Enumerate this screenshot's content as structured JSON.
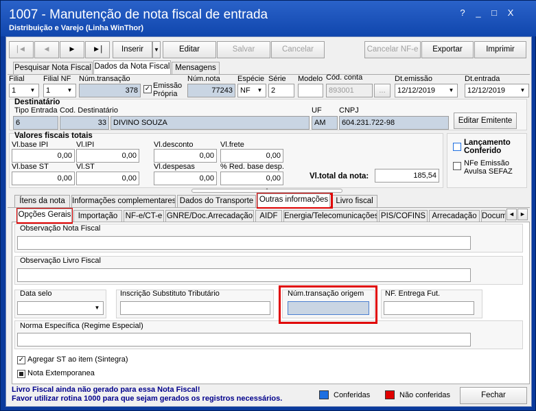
{
  "window": {
    "title": "1007 - Manutenção de nota fiscal de entrada",
    "subtitle": "Distribuição e Varejo (Linha WinThor)",
    "controls": [
      "?",
      "_",
      "□",
      "X"
    ]
  },
  "toolbar": {
    "first": "|◄",
    "prev": "◄",
    "next": "►",
    "last": "►|",
    "insert": "Inserir",
    "edit": "Editar",
    "save": "Salvar",
    "cancel": "Cancelar",
    "cancel_nfe": "Cancelar NF-e",
    "export": "Exportar",
    "print": "Imprimir"
  },
  "main_tabs": [
    "Pesquisar Nota Fiscal",
    "Dados da Nota Fiscal",
    "Mensagens"
  ],
  "header_fields": {
    "filial_label": "Filial",
    "filial_value": "1",
    "filial_nf_label": "Filial NF",
    "filial_nf_value": "1",
    "num_transacao_label": "Núm.transação",
    "num_transacao_value": "378",
    "emissao_propria_label": "Emissão Própria",
    "num_nota_label": "Núm.nota",
    "num_nota_value": "77243",
    "especie_label": "Espécie",
    "especie_value": "NF",
    "serie_label": "Série",
    "serie_value": "2",
    "modelo_label": "Modelo",
    "modelo_value": "",
    "cod_conta_label": "Cód. conta",
    "cod_conta_value": "893001",
    "cod_conta_btn": "...",
    "dt_emissao_label": "Dt.emissão",
    "dt_emissao_value": "12/12/2019",
    "dt_entrada_label": "Dt.entrada",
    "dt_entrada_value": "12/12/2019"
  },
  "destinatario": {
    "title": "Destinatário",
    "tipo_entrada_label": "Tipo Entrada",
    "tipo_entrada_value": "6",
    "cod_dest_label": "Cod. Destinatário",
    "cod_dest_value": "33",
    "nome_value": "DIVINO SOUZA",
    "uf_label": "UF",
    "uf_value": "AM",
    "cnpj_label": "CNPJ",
    "cnpj_value": "604.231.722-98",
    "edit_btn": "Editar Emitente"
  },
  "valores": {
    "title": "Valores fiscais totais",
    "vl_base_ipi_label": "Vl.base IPI",
    "vl_base_ipi": "0,00",
    "vl_ipi_label": "Vl.IPI",
    "vl_ipi": "0,00",
    "vl_desconto_label": "Vl.desconto",
    "vl_desconto": "0,00",
    "vl_frete_label": "Vl.frete",
    "vl_frete": "0,00",
    "vl_base_st_label": "Vl.base ST",
    "vl_base_st": "0,00",
    "vl_st_label": "Vl.ST",
    "vl_st": "0,00",
    "vl_despesas_label": "Vl.despesas",
    "vl_despesas": "0,00",
    "red_base_label": "% Red. base desp.",
    "red_base": "0,00",
    "vl_total_label": "Vl.total da nota:",
    "vl_total": "185,54"
  },
  "right_checks": {
    "lancamento": "Lançamento Conferido",
    "nfe_emissao": "NFe Emissão Avulsa SEFAZ"
  },
  "sub_tabs": [
    "Ítens da nota",
    "Informações complementares",
    "Dados do Transporte",
    "Outras informações",
    "Livro fiscal"
  ],
  "inner_tabs": [
    "Opções Gerais",
    "Importação",
    "NF-e/CT-e",
    "GNRE/Doc.Arrecadação",
    "AIDF",
    "Energia/Telecomunicações",
    "PIS/COFINS",
    "Arrecadação",
    "Docum"
  ],
  "opcoes_gerais": {
    "obs_nota_label": "Observação Nota Fiscal",
    "obs_nota_value": "",
    "obs_livro_label": "Observação Livro Fiscal",
    "obs_livro_value": "",
    "data_selo_label": "Data selo",
    "data_selo_value": "",
    "inscricao_label": "Inscrição Substituto Tributário",
    "inscricao_value": "",
    "num_origem_label": "Núm.transação origem",
    "num_origem_value": "",
    "nf_entrega_label": "NF. Entrega Fut.",
    "nf_entrega_value": "",
    "norma_label": "Norma Específica (Regime Especial)",
    "norma_value": "",
    "agregar_st_label": "Agregar ST ao item (Sintegra)",
    "nota_extemp_label": "Nota Extemporanea"
  },
  "footer": {
    "warning_line1": "Livro Fiscal ainda não gerado para essa Nota Fiscal!",
    "warning_line2": "Favor utilizar rotina 1000 para que sejam gerados os registros necessários.",
    "legend_conferidas": "Conferidas",
    "legend_nao_conferidas": "Não conferidas",
    "close_btn": "Fechar"
  },
  "colors": {
    "title_bar": "#1a52b8",
    "highlight_red": "#e00000",
    "legend_blue": "#1e6fe0",
    "legend_red": "#e00000",
    "warning_text": "#00008b",
    "readonly_field": "#c9d5e3"
  }
}
